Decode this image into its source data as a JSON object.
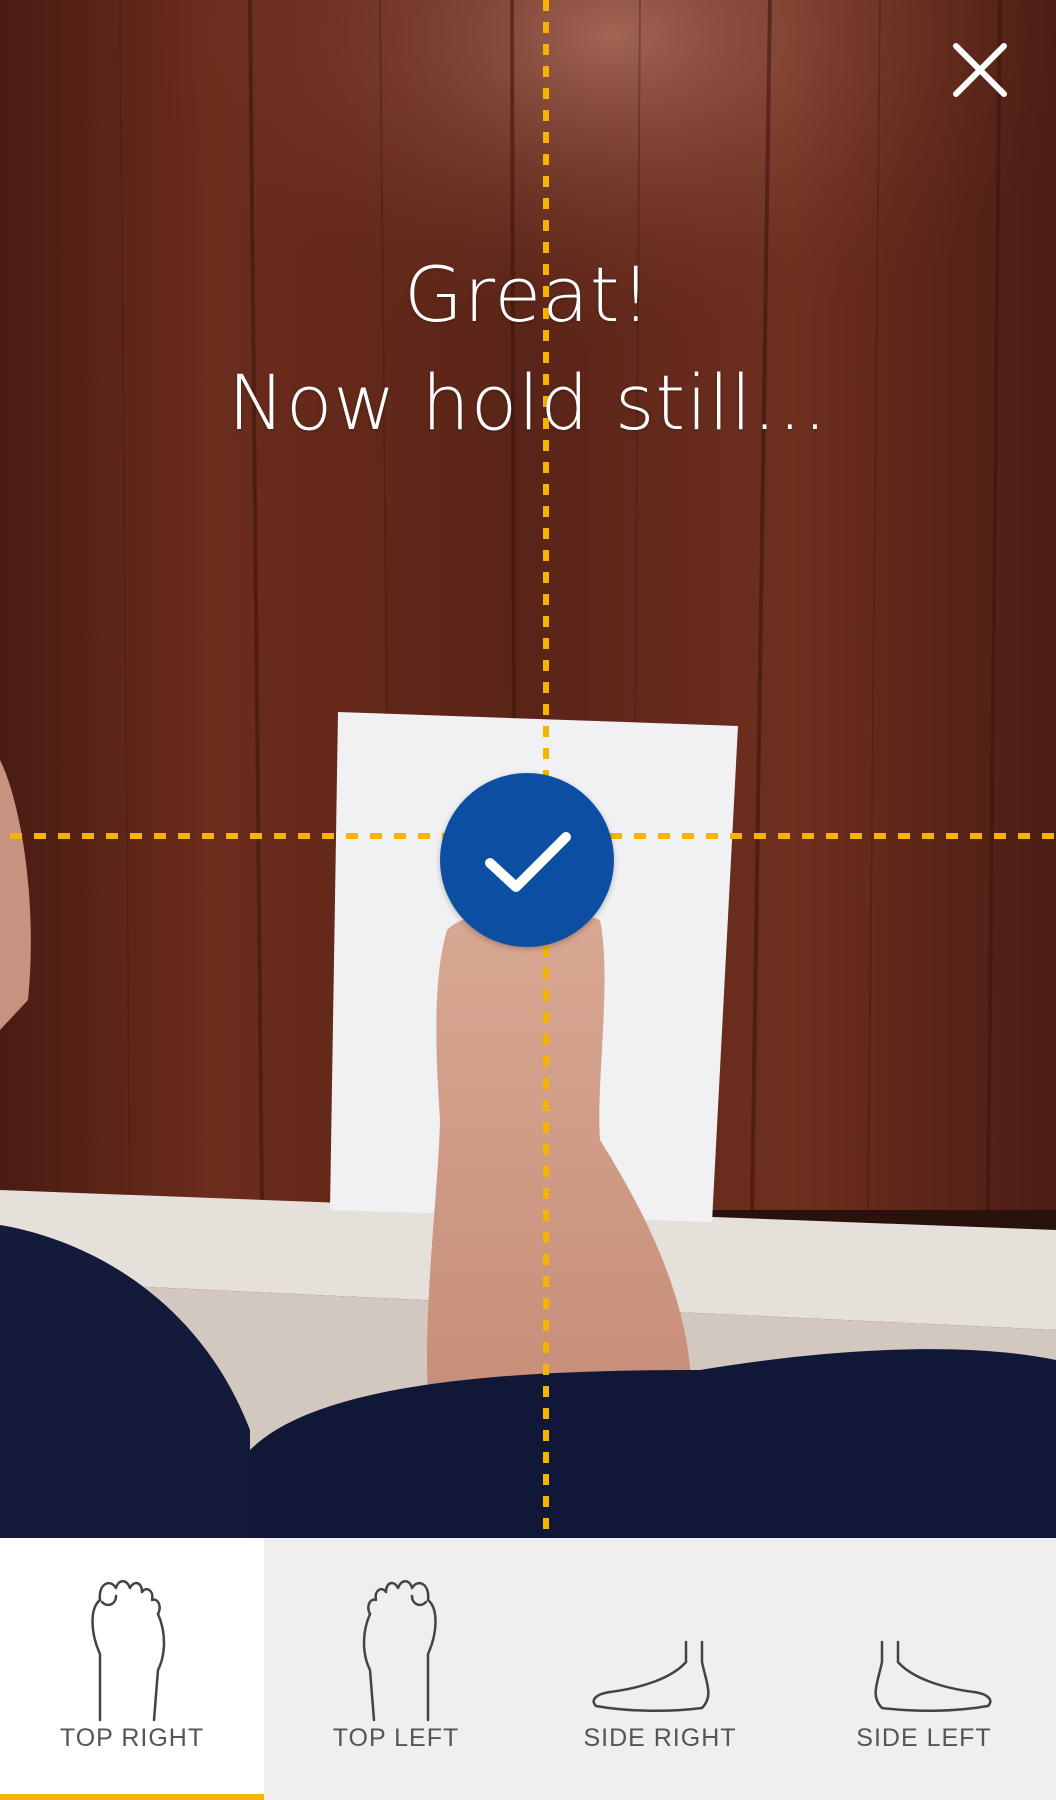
{
  "camera": {
    "prompt_line1": "Great!",
    "prompt_line2": "Now hold still...",
    "close_icon": "close-icon",
    "status_icon": "checkmark-icon",
    "guide_color": "#f4b400",
    "badge_color": "#0b4ea2"
  },
  "tabs": [
    {
      "label": "TOP RIGHT",
      "icon": "foot-top-right-icon",
      "active": true
    },
    {
      "label": "TOP LEFT",
      "icon": "foot-top-left-icon",
      "active": false
    },
    {
      "label": "SIDE RIGHT",
      "icon": "foot-side-right-icon",
      "active": false
    },
    {
      "label": "SIDE LEFT",
      "icon": "foot-side-left-icon",
      "active": false
    }
  ],
  "theme": {
    "accent": "#f4b400",
    "tabbar_bg": "#f0eeee",
    "active_tab_bg": "#ffffff",
    "label_color": "#555555"
  }
}
